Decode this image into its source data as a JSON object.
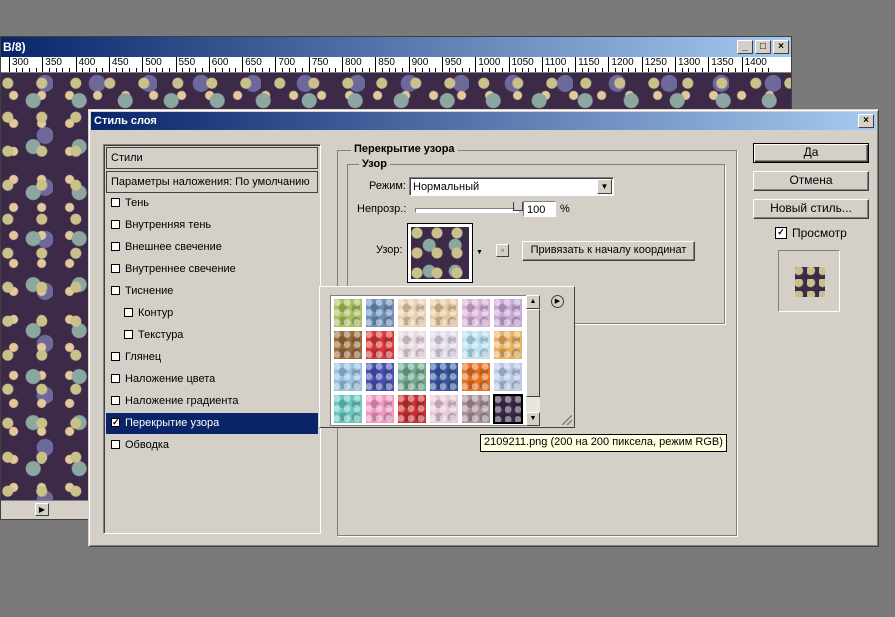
{
  "document": {
    "title": "B/8)",
    "ruler_labels": [
      "300",
      "350",
      "400",
      "450",
      "500",
      "550",
      "600",
      "650",
      "700",
      "750",
      "800",
      "850",
      "900",
      "950",
      "1000",
      "1050",
      "1100",
      "1150",
      "1200",
      "1250",
      "1300",
      "1350",
      "1400"
    ]
  },
  "dialog": {
    "title": "Стиль слоя",
    "styles_header": "Стили",
    "blend_header": "Параметры наложения: По умолчанию",
    "style_items": [
      {
        "label": "Тень",
        "checked": false
      },
      {
        "label": "Внутренняя тень",
        "checked": false
      },
      {
        "label": "Внешнее свечение",
        "checked": false
      },
      {
        "label": "Внутреннее свечение",
        "checked": false
      },
      {
        "label": "Тиснение",
        "checked": false
      },
      {
        "label": "Контур",
        "checked": false
      },
      {
        "label": "Текстура",
        "checked": false
      },
      {
        "label": "Глянец",
        "checked": false
      },
      {
        "label": "Наложение цвета",
        "checked": false
      },
      {
        "label": "Наложение градиента",
        "checked": false
      },
      {
        "label": "Перекрытие узора",
        "checked": true
      },
      {
        "label": "Обводка",
        "checked": false
      }
    ],
    "section_title": "Перекрытие узора",
    "group_title": "Узор",
    "mode_label": "Режим:",
    "mode_value": "Нормальный",
    "opacity_label": "Непрозр.:",
    "opacity_value": "100",
    "opacity_level": 1.0,
    "percent": "%",
    "pattern_label": "Узор:",
    "snap_button": "Привязать к началу координат",
    "ok_button": "Да",
    "cancel_button": "Отмена",
    "new_style_button": "Новый стиль...",
    "preview_label": "Просмотр",
    "preview_checked": true
  },
  "picker": {
    "swatches": [
      "#a8c060",
      "#6f8fb8",
      "#e8d0b0",
      "#e8c8a0",
      "#d8b0d8",
      "#c8a8d8",
      "#9a6a3a",
      "#d83838",
      "#e8d8e0",
      "#e0d8e8",
      "#b8e0f0",
      "#e8b060",
      "#98c0e0",
      "#4850b0",
      "#70a890",
      "#3858a0",
      "#e87020",
      "#b8c8e8",
      "#68c8c0",
      "#f098c0",
      "#c83030",
      "#e8c8d8",
      "#a89098",
      "#3c2a48"
    ],
    "tooltip": "2109211.png (200 на 200 пиксела, режим RGB)"
  }
}
